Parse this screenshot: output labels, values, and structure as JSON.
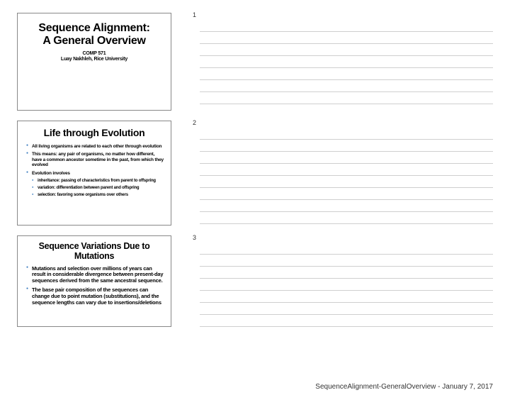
{
  "footer": "SequenceAlignment-GeneralOverview - January 7, 2017",
  "slides": [
    {
      "num": "1",
      "title_l1": "Sequence Alignment:",
      "title_l2": "A General Overview",
      "course": "COMP 571",
      "author": "Luay Nakhleh, Rice University"
    },
    {
      "num": "2",
      "title": "Life through Evolution",
      "b1": "All living organisms are related to each other through evolution",
      "b2": "This means: any pair of organisms, no matter how different, have a common ancestor sometime in the past, from which they evolved",
      "b3": "Evolution involves",
      "b3a": "inheritance: passing of characteristics from parent to offspring",
      "b3b": "variation: differentiation between parent and offspring",
      "b3c": "selection: favoring some organisms over others"
    },
    {
      "num": "3",
      "title_l1": "Sequence Variations Due to",
      "title_l2": "Mutations",
      "b1": "Mutations and selection over millions of years can result in considerable divergence between present-day sequences derived from the same ancestral sequence.",
      "b2": "The base pair composition of the sequences can change due to point mutation (substitutions), and the sequence lengths can vary due to insertions/deletions"
    }
  ]
}
